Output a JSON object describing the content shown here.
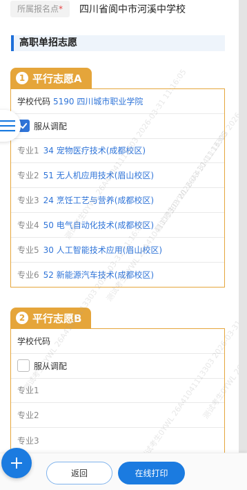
{
  "school": {
    "label": "所属报名点",
    "required_mark": "*",
    "value": "四川省阆中市河溪中学校"
  },
  "section_title": "高职单招志愿",
  "volunteers": [
    {
      "number": "1",
      "title": "平行志愿A",
      "school_code_label": "学校代码",
      "school_code_value": "5190 四川城市职业学院",
      "obey_label": "服从调配",
      "obey_checked": true,
      "majors": [
        {
          "label": "专业1",
          "value": "34 宠物医疗技术(成都校区)"
        },
        {
          "label": "专业2",
          "value": "51 无人机应用技术(眉山校区)"
        },
        {
          "label": "专业3",
          "value": "24 烹饪工艺与营养(成都校区)"
        },
        {
          "label": "专业4",
          "value": "50 电气自动化技术(成都校区)"
        },
        {
          "label": "专业5",
          "value": "30 人工智能技术应用(眉山校区)"
        },
        {
          "label": "专业6",
          "value": "52 新能源汽车技术(成都校区)"
        }
      ]
    },
    {
      "number": "2",
      "title": "平行志愿B",
      "school_code_label": "学校代码",
      "school_code_value": "",
      "obey_label": "服从调配",
      "obey_checked": false,
      "majors": [
        {
          "label": "专业1",
          "value": ""
        },
        {
          "label": "专业2",
          "value": ""
        },
        {
          "label": "专业3",
          "value": ""
        }
      ]
    }
  ],
  "buttons": {
    "back": "返回",
    "print": "在线打印"
  },
  "watermark": "测试考生0YWL 26A41041113303 2026-03-31 11:16:05",
  "colors": {
    "accent": "#1b7be0",
    "volunteer_tab": "#e5a53a",
    "link": "#2f74d8"
  },
  "icons": {
    "menu": "menu-icon",
    "fab": "plus-icon",
    "check": "check-icon"
  }
}
